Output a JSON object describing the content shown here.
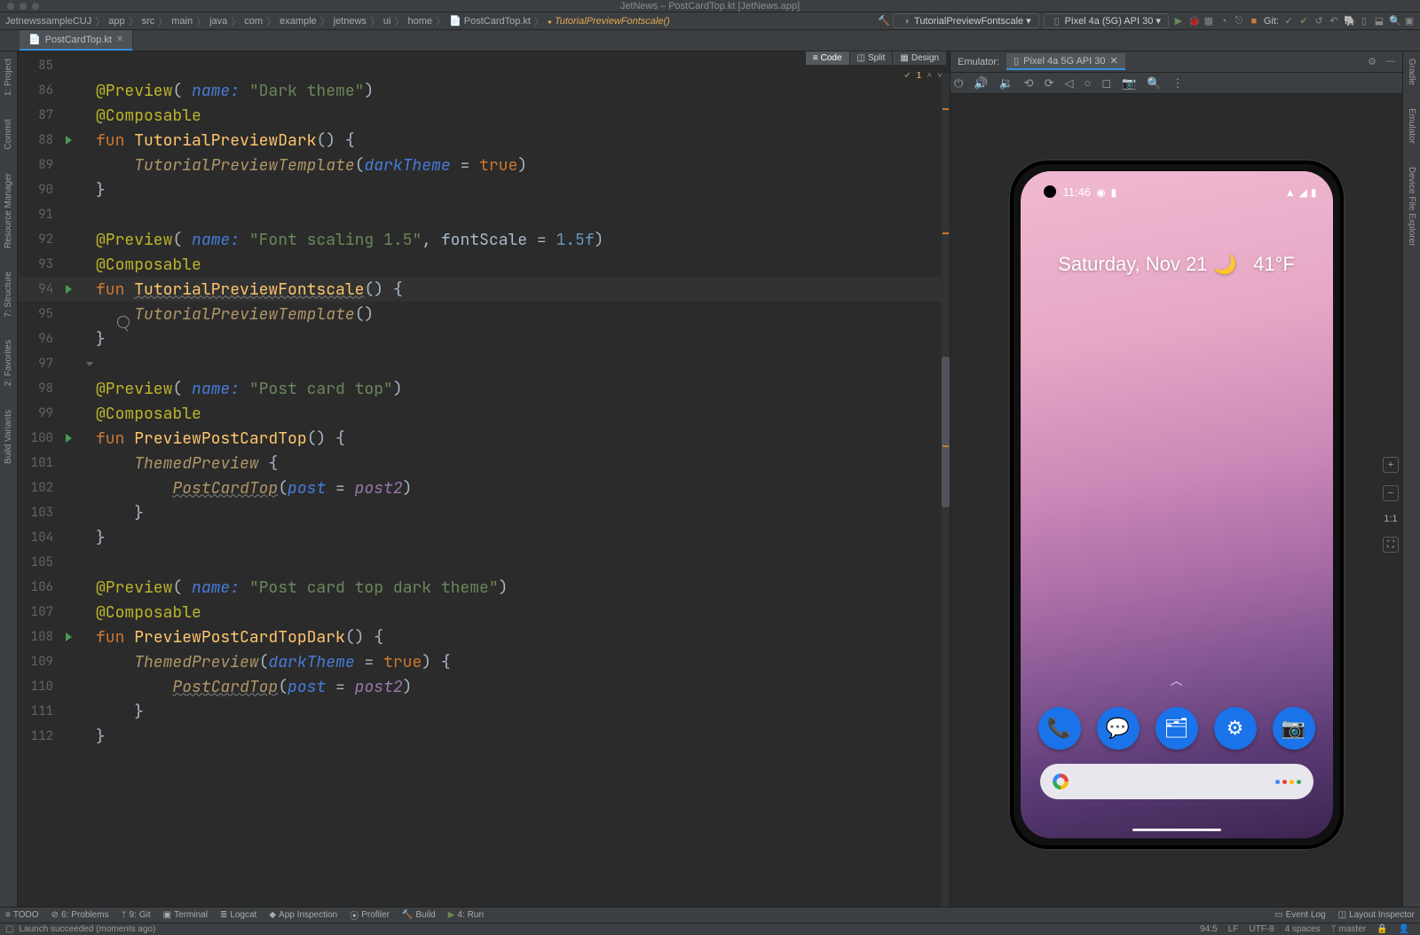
{
  "window_title": "JetNews – PostCardTop.kt [JetNews.app]",
  "breadcrumbs": [
    "JetnewssampleCUJ",
    "app",
    "src",
    "main",
    "java",
    "com",
    "example",
    "jetnews",
    "ui",
    "home"
  ],
  "breadcrumb_file": "PostCardTop.kt",
  "breadcrumb_function": "TutorialPreviewFontscale()",
  "run_config": "TutorialPreviewFontscale",
  "device_target": "Pixel 4a (5G) API 30",
  "git_label": "Git:",
  "tab": {
    "name": "PostCardTop.kt"
  },
  "view_modes": {
    "code": "Code",
    "split": "Split",
    "design": "Design"
  },
  "warnings": {
    "count": "1"
  },
  "emulator": {
    "label": "Emulator:",
    "tab": "Pixel 4a 5G API 30",
    "status_time": "11:46",
    "weather_date": "Saturday, Nov 21",
    "temperature": "41°F",
    "zoom_label": "1:1"
  },
  "bottom": {
    "todo": "TODO",
    "problems": "Problems",
    "git": "Git",
    "terminal": "Terminal",
    "logcat": "Logcat",
    "inspection": "App Inspection",
    "profiler": "Profiler",
    "build": "Build",
    "run": "Run",
    "eventlog": "Event Log",
    "layout": "Layout Inspector"
  },
  "status": {
    "left": "Launch succeeded (moments ago)",
    "pos": "94:5",
    "lf": "LF",
    "enc": "UTF-8",
    "indent": "4 spaces",
    "branch": "master"
  },
  "lines": [
    {
      "n": 85,
      "run": false,
      "html": ""
    },
    {
      "n": 86,
      "run": false,
      "html": "<span class='ann'>@Preview</span><span class='punct'>( </span><span class='named'>name:</span> <span class='str'>\"Dark theme\"</span><span class='punct'>)</span>"
    },
    {
      "n": 87,
      "run": false,
      "html": "<span class='ann'>@Composable</span>"
    },
    {
      "n": 88,
      "run": true,
      "html": "<span class='kw'>fun</span> <span class='fnname'>TutorialPreviewDark</span><span class='punct'>() {</span>"
    },
    {
      "n": 89,
      "run": false,
      "html": "    <span class='call'>TutorialPreviewTemplate</span><span class='punct'>(</span><span class='named'>darkTheme</span> <span class='punct'>=</span> <span class='bool'>true</span><span class='punct'>)</span>"
    },
    {
      "n": 90,
      "run": false,
      "html": "<span class='punct'>}</span>"
    },
    {
      "n": 91,
      "run": false,
      "html": ""
    },
    {
      "n": 92,
      "run": false,
      "html": "<span class='ann'>@Preview</span><span class='punct'>( </span><span class='named'>name:</span> <span class='str'>\"Font scaling 1.5\"</span><span class='punct'>, </span><span class='punct'>fontScale = </span><span class='num'>1.5f</span><span class='punct'>)</span>"
    },
    {
      "n": 93,
      "run": false,
      "html": "<span class='ann'>@Composable</span>"
    },
    {
      "n": 94,
      "run": true,
      "hl": true,
      "html": "<span class='kw'>fun</span> <span class='fnname underline-wave'>TutorialPreviewFontscale</span><span class='punct'>() {</span>"
    },
    {
      "n": 95,
      "run": false,
      "html": "    <span class='call'>TutorialPreviewTemplate</span><span class='punct'>()</span>"
    },
    {
      "n": 96,
      "run": false,
      "html": "<span class='punct'>}</span>"
    },
    {
      "n": 97,
      "run": false,
      "tri": true,
      "html": ""
    },
    {
      "n": 98,
      "run": false,
      "html": "<span class='ann'>@Preview</span><span class='punct'>( </span><span class='named'>name:</span> <span class='str'>\"Post card top\"</span><span class='punct'>)</span>"
    },
    {
      "n": 99,
      "run": false,
      "html": "<span class='ann'>@Composable</span>"
    },
    {
      "n": 100,
      "run": true,
      "html": "<span class='kw'>fun</span> <span class='fnname'>PreviewPostCardTop</span><span class='punct'>() {</span>"
    },
    {
      "n": 101,
      "run": false,
      "html": "    <span class='call'>ThemedPreview</span> <span class='punct'>{</span>"
    },
    {
      "n": 102,
      "run": false,
      "html": "        <span class='call underline-wave'>PostCardTop</span><span class='punct'>(</span><span class='named'>post</span> <span class='punct'>=</span> <span class='ident'>post2</span><span class='punct'>)</span>"
    },
    {
      "n": 103,
      "run": false,
      "html": "    <span class='punct'>}</span>"
    },
    {
      "n": 104,
      "run": false,
      "html": "<span class='punct'>}</span>"
    },
    {
      "n": 105,
      "run": false,
      "html": ""
    },
    {
      "n": 106,
      "run": false,
      "html": "<span class='ann'>@Preview</span><span class='punct'>( </span><span class='named'>name:</span> <span class='str'>\"Post card top dark theme\"</span><span class='punct'>)</span>"
    },
    {
      "n": 107,
      "run": false,
      "html": "<span class='ann'>@Composable</span>"
    },
    {
      "n": 108,
      "run": true,
      "html": "<span class='kw'>fun</span> <span class='fnname'>PreviewPostCardTopDark</span><span class='punct'>() {</span>"
    },
    {
      "n": 109,
      "run": false,
      "html": "    <span class='call'>ThemedPreview</span><span class='punct'>(</span><span class='named'>darkTheme</span> <span class='punct'>=</span> <span class='bool'>true</span><span class='punct'>) {</span>"
    },
    {
      "n": 110,
      "run": false,
      "html": "        <span class='call underline-wave'>PostCardTop</span><span class='punct'>(</span><span class='named'>post</span> <span class='punct'>=</span> <span class='ident'>post2</span><span class='punct'>)</span>"
    },
    {
      "n": 111,
      "run": false,
      "html": "    <span class='punct'>}</span>"
    },
    {
      "n": 112,
      "run": false,
      "html": "<span class='punct'>}</span>"
    }
  ],
  "left_sidebar": [
    "1: Project",
    "Resource Manager",
    "Commit"
  ],
  "right_sidebar": [
    "Gradle",
    "Emulator",
    "Device File Explorer"
  ]
}
